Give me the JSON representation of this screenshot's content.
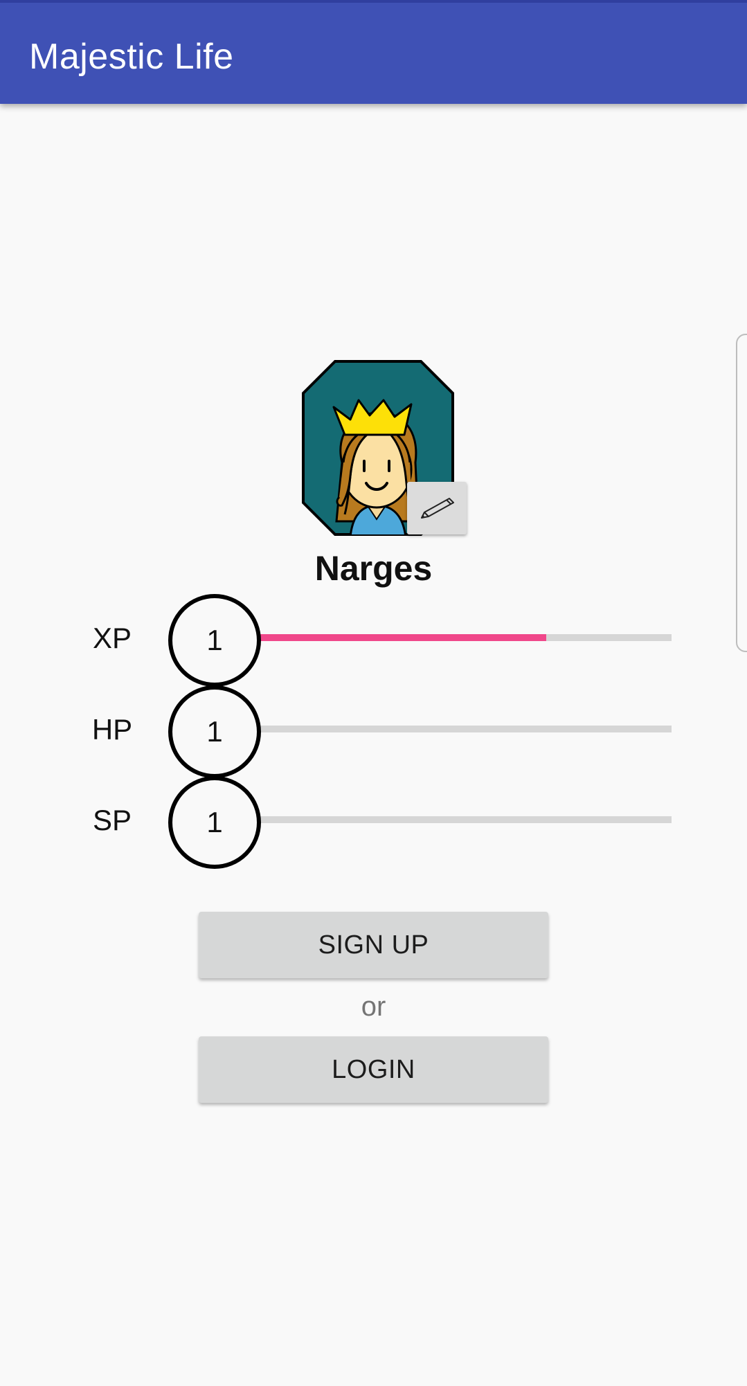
{
  "app_bar": {
    "title": "Majestic Life",
    "color": "#3f51b5"
  },
  "profile": {
    "username": "Narges",
    "avatar_icon": "queen-avatar-icon",
    "edit_icon": "pencil-icon"
  },
  "stats": [
    {
      "label": "XP",
      "level": "1",
      "progress": 0.7,
      "bar_color": "#f0478a"
    },
    {
      "label": "HP",
      "level": "1",
      "progress": 0,
      "bar_color": "#f0478a"
    },
    {
      "label": "SP",
      "level": "1",
      "progress": 0,
      "bar_color": "#f0478a"
    }
  ],
  "actions": {
    "signup_label": "SIGN UP",
    "or_label": "or",
    "login_label": "LOGIN"
  }
}
